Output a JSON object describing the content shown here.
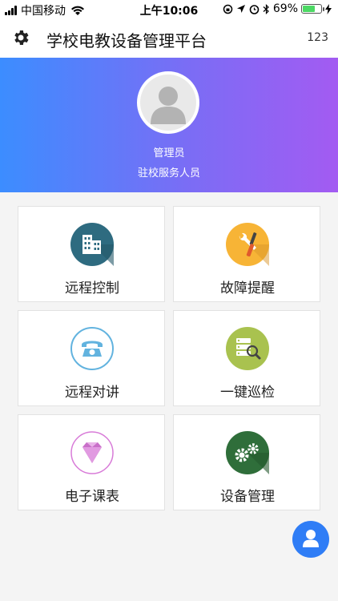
{
  "status_bar": {
    "carrier": "中国移动",
    "time": "上午10:06",
    "battery_text": "69%",
    "battery_level": 0.69
  },
  "nav": {
    "title": "学校电教设备管理平台",
    "right_text": "123",
    "settings_icon": "gear-icon"
  },
  "profile": {
    "name": "管理员",
    "role": "驻校服务人员",
    "avatar_icon": "user-avatar-icon"
  },
  "menu": [
    {
      "label": "远程控制",
      "icon": "building-icon",
      "color": "#2e6b80"
    },
    {
      "label": "故障提醒",
      "icon": "tools-icon",
      "color": "#f7b436"
    },
    {
      "label": "远程对讲",
      "icon": "telephone-icon",
      "color": "#62b3df"
    },
    {
      "label": "一键巡检",
      "icon": "server-search-icon",
      "color": "#a9c24f"
    },
    {
      "label": "电子课表",
      "icon": "diamond-icon",
      "color": "#d87bd8"
    },
    {
      "label": "设备管理",
      "icon": "gears-icon",
      "color": "#2f6e3a"
    }
  ],
  "fab": {
    "icon": "user-icon",
    "color": "#2f7df6"
  }
}
